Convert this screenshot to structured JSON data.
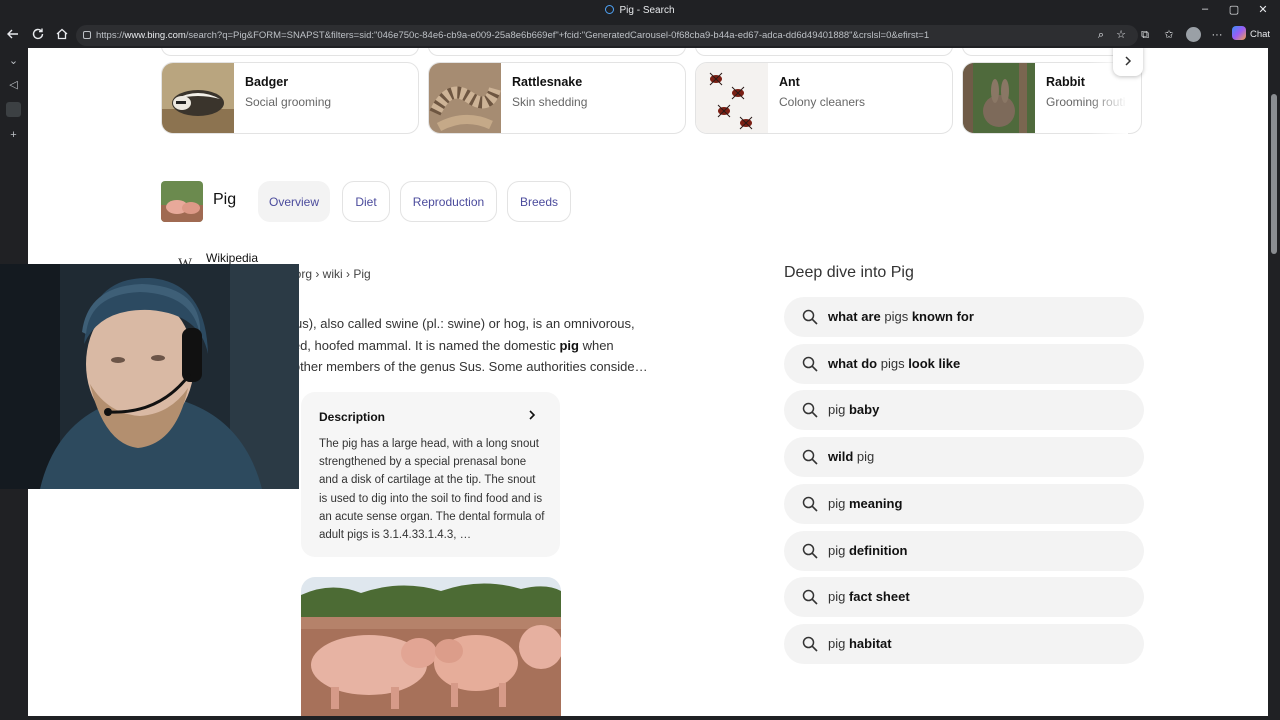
{
  "window": {
    "title": "Pig - Search",
    "controls": [
      "–",
      "▢",
      "✕"
    ]
  },
  "address_bar": {
    "url_prefix": "https://",
    "url_host": "www.bing.com",
    "url_rest": "/search?q=Pig&FORM=SNAPST&filters=sid:\"046e750c-84e6-cb9a-e009-25a8e6b669ef\"+fcid:\"GeneratedCarousel-0f68cba9-b44a-ed67-adca-dd6d49401888\"&crslsl=0&efirst=1",
    "chat_label": "Chat"
  },
  "carousel": {
    "items": [
      {
        "name": "Badger",
        "subtitle": "Social grooming"
      },
      {
        "name": "Rattlesnake",
        "subtitle": "Skin shedding"
      },
      {
        "name": "Ant",
        "subtitle": "Colony cleaners"
      },
      {
        "name": "Rabbit",
        "subtitle": "Grooming routi"
      }
    ]
  },
  "entity": {
    "name": "Pig",
    "tabs": [
      "Overview",
      "Diet",
      "Reproduction",
      "Breeds"
    ]
  },
  "wiki": {
    "source": "Wikipedia",
    "logo_letter": "W",
    "breadcrumb": "ia.org › wiki › Pig",
    "summary_1": "ticus), also called swine (pl.: swine) or hog, is an omnivorous,",
    "summary_2a": "toed, hoofed mammal. It is named the domestic ",
    "summary_2b": "pig",
    "summary_2c": " when",
    "summary_3": "n other members of the genus Sus. Some authorities conside…"
  },
  "description": {
    "title": "Description",
    "text": "The pig has a large head, with a long snout strengthened by a special prenasal bone and a disk of cartilage at the tip. The snout is used to dig into the soil to find food and is an acute sense organ. The dental formula of adult pigs is 3.1.4.33.1.4.3, …"
  },
  "deep_dive": {
    "title": "Deep dive into Pig",
    "suggestions": [
      {
        "parts": [
          {
            "t": "what are",
            "b": true
          },
          {
            "t": " pigs ",
            "b": false
          },
          {
            "t": "known for",
            "b": true
          }
        ]
      },
      {
        "parts": [
          {
            "t": "what do",
            "b": true
          },
          {
            "t": " pigs ",
            "b": false
          },
          {
            "t": "look like",
            "b": true
          }
        ]
      },
      {
        "parts": [
          {
            "t": "pig ",
            "b": false
          },
          {
            "t": "baby",
            "b": true
          }
        ]
      },
      {
        "parts": [
          {
            "t": "wild",
            "b": true
          },
          {
            "t": " pig",
            "b": false
          }
        ]
      },
      {
        "parts": [
          {
            "t": "pig ",
            "b": false
          },
          {
            "t": "meaning",
            "b": true
          }
        ]
      },
      {
        "parts": [
          {
            "t": "pig ",
            "b": false
          },
          {
            "t": "definition",
            "b": true
          }
        ]
      },
      {
        "parts": [
          {
            "t": "pig ",
            "b": false
          },
          {
            "t": "fact sheet",
            "b": true
          }
        ]
      },
      {
        "parts": [
          {
            "t": "pig ",
            "b": false
          },
          {
            "t": "habitat",
            "b": true
          }
        ]
      }
    ]
  },
  "icons": {
    "back": "back-arrow-icon",
    "refresh": "refresh-icon",
    "home": "home-icon",
    "next": "chevron-right-icon",
    "search": "search-icon"
  },
  "colors": {
    "tab_text": "#4b4b9c",
    "suggestion_bg": "#f3f3f3",
    "chrome_bg": "#202124"
  }
}
